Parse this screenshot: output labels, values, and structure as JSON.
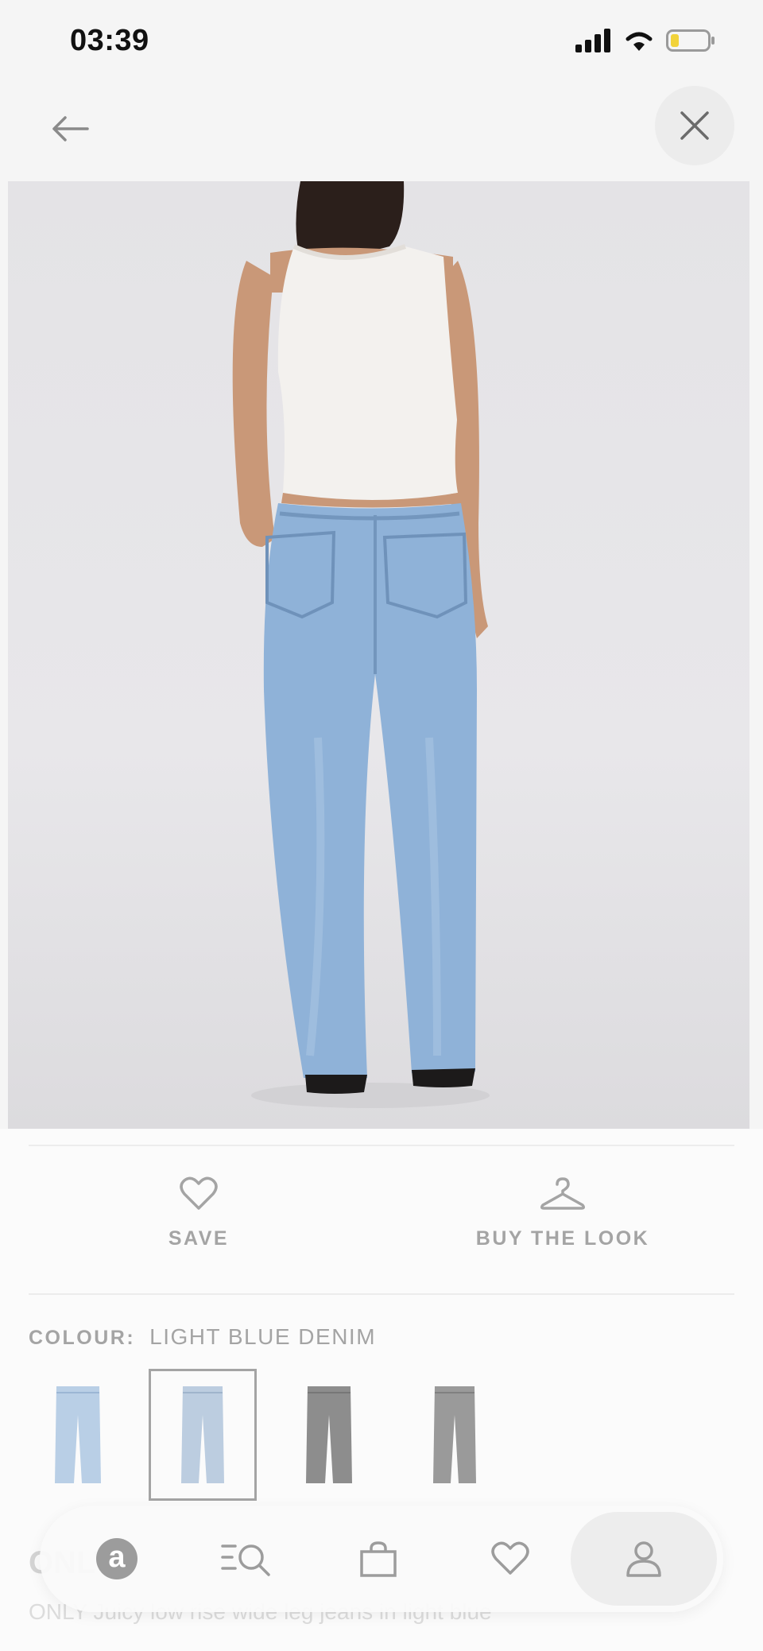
{
  "status_bar": {
    "time": "03:39"
  },
  "icons": {
    "back": "arrow-left-icon",
    "close": "close-icon",
    "save": "heart-icon",
    "buy_the_look": "hanger-icon"
  },
  "actions": {
    "save_label": "SAVE",
    "buy_the_look_label": "BUY THE LOOK"
  },
  "colour": {
    "label": "COLOUR:",
    "value": "LIGHT BLUE DENIM",
    "swatches": [
      {
        "name": "light blue denim",
        "color": "#b9cfe6",
        "selected": false
      },
      {
        "name": "light blue denim",
        "color": "#bccde0",
        "selected": true
      },
      {
        "name": "grey denim",
        "color": "#8d8d8d",
        "selected": false
      },
      {
        "name": "grey denim",
        "color": "#9a9a9a",
        "selected": false
      }
    ]
  },
  "product": {
    "title_partial": "ONLY",
    "description": "ONLY Juicy low rise wide leg jeans in light blue"
  },
  "bottom_nav": {
    "items": [
      "home-logo",
      "search-icon",
      "bag-icon",
      "saved-icon",
      "account-icon"
    ],
    "logo_letter": "a"
  },
  "colors": {
    "muted_text": "#a4a4a4",
    "sheet_bg": "#fbfbfb",
    "battery_fill": "#f2d33a"
  }
}
